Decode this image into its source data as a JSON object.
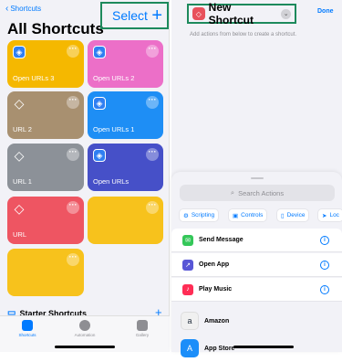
{
  "left": {
    "back_label": "Shortcuts",
    "title": "All Shortcuts",
    "select_label": "Select",
    "add_symbol": "+",
    "tiles": [
      {
        "label": "Open URLs 3",
        "color": "#f5b800"
      },
      {
        "label": "Open URLs 2",
        "color": "#ec6fc8"
      },
      {
        "label": "URL 2",
        "color": "#a89070"
      },
      {
        "label": "Open URLs 1",
        "color": "#1e8ef5"
      },
      {
        "label": "URL 1",
        "color": "#8c9198"
      },
      {
        "label": "Open URLs",
        "color": "#4650c8"
      },
      {
        "label": "URL",
        "color": "#ee5562"
      },
      {
        "label": "",
        "color": "#f7c21c"
      },
      {
        "label": "",
        "color": "#f7c21c"
      }
    ],
    "starter_label": "Starter Shortcuts",
    "tabs": [
      {
        "label": "Shortcuts"
      },
      {
        "label": "Automation"
      },
      {
        "label": "Gallery"
      }
    ]
  },
  "right": {
    "title": "New Shortcut",
    "done_label": "Done",
    "hint": "Add actions from below to create a shortcut.",
    "search_placeholder": "Search Actions",
    "chips": [
      {
        "label": "Scripting"
      },
      {
        "label": "Controls"
      },
      {
        "label": "Device"
      },
      {
        "label": "Loc"
      }
    ],
    "actions": [
      {
        "label": "Send Message",
        "color": "#34c759"
      },
      {
        "label": "Open App",
        "color": "#5856d6"
      },
      {
        "label": "Play Music",
        "color": "#ff2d55"
      }
    ],
    "apps": [
      {
        "label": "Amazon",
        "color": "#232f3e"
      },
      {
        "label": "App Store",
        "color": "#1c8ef9"
      }
    ]
  }
}
